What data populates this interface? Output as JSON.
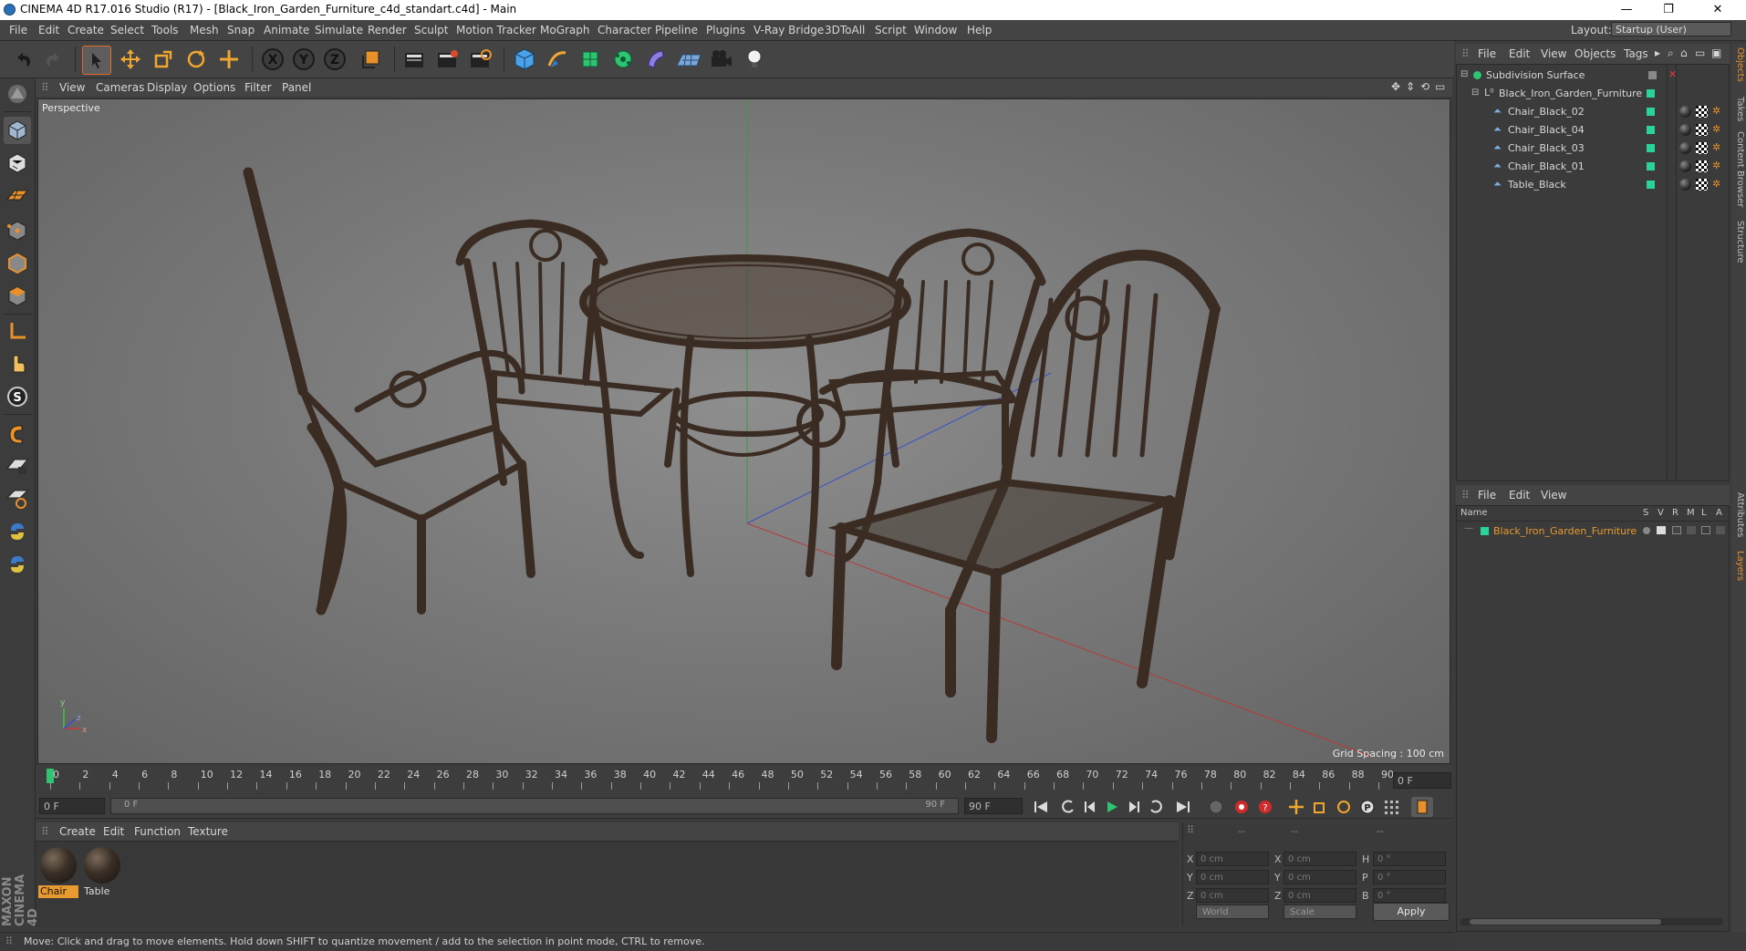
{
  "window": {
    "title": "CINEMA 4D R17.016 Studio (R17) - [Black_Iron_Garden_Furniture_c4d_standart.c4d] - Main",
    "minimize": "—",
    "restore": "❐",
    "close": "✕"
  },
  "menubar": {
    "items": [
      "File",
      "Edit",
      "Create",
      "Select",
      "Tools",
      "Mesh",
      "Snap",
      "Animate",
      "Simulate",
      "Render",
      "Sculpt",
      "Motion Tracker",
      "MoGraph",
      "Character",
      "Pipeline",
      "Plugins",
      "V-Ray Bridge",
      "3DToAll",
      "Script",
      "Window",
      "Help"
    ],
    "layout_label": "Layout:",
    "layout_value": "Startup (User)"
  },
  "toolbar": {
    "icons": [
      "undo-icon",
      "redo-icon",
      "select-icon",
      "move-icon",
      "scale-icon",
      "rotate-icon",
      "live-select-icon",
      "x-axis-icon",
      "y-axis-icon",
      "z-axis-icon",
      "coordinate-system-icon",
      "render-view-icon",
      "render-picture-icon",
      "render-settings-icon",
      "cube-icon",
      "pen-icon",
      "subdivision-icon",
      "cloner-icon",
      "deformer-icon",
      "floor-icon",
      "camera-icon",
      "light-icon"
    ],
    "x_label": "X",
    "y_label": "Y",
    "z_label": "Z"
  },
  "viewport": {
    "menu": [
      "View",
      "Cameras",
      "Display",
      "Options",
      "Filter",
      "Panel"
    ],
    "label": "Perspective",
    "grid_spacing": "Grid Spacing : 100 cm",
    "axis_y": "y",
    "axis_z": "z",
    "axis_x": "x"
  },
  "timeline": {
    "ticks": [
      "0",
      "2",
      "4",
      "6",
      "8",
      "10",
      "12",
      "14",
      "16",
      "18",
      "20",
      "22",
      "24",
      "26",
      "28",
      "30",
      "32",
      "34",
      "36",
      "38",
      "40",
      "42",
      "44",
      "46",
      "48",
      "50",
      "52",
      "54",
      "56",
      "58",
      "60",
      "62",
      "64",
      "66",
      "68",
      "70",
      "72",
      "74",
      "76",
      "78",
      "80",
      "82",
      "84",
      "86",
      "88",
      "90"
    ],
    "current_frame_field": "0 F",
    "start_field": "0 F",
    "range_start": "0 F",
    "range_end": "90 F",
    "end_field": "90 F"
  },
  "materials": {
    "menu": [
      "Create",
      "Edit",
      "Function",
      "Texture"
    ],
    "items": [
      {
        "name": "Chair",
        "selected": true
      },
      {
        "name": "Table",
        "selected": false
      }
    ],
    "logo": "MAXON CINEMA 4D"
  },
  "coordinates": {
    "headers": [
      "--",
      "--",
      "--"
    ],
    "rows": [
      {
        "l1": "X",
        "v1": "0 cm",
        "l2": "X",
        "v2": "0 cm",
        "l3": "H",
        "v3": "0 °"
      },
      {
        "l1": "Y",
        "v1": "0 cm",
        "l2": "Y",
        "v2": "0 cm",
        "l3": "P",
        "v3": "0 °"
      },
      {
        "l1": "Z",
        "v1": "0 cm",
        "l2": "Z",
        "v2": "0 cm",
        "l3": "B",
        "v3": "0 °"
      }
    ],
    "mode_world": "World",
    "mode_scale": "Scale",
    "apply": "Apply"
  },
  "status": {
    "text": "Move: Click and drag to move elements. Hold down SHIFT to quantize movement / add to the selection in point mode, CTRL to remove."
  },
  "object_manager": {
    "menu": [
      "File",
      "Edit",
      "View",
      "Objects",
      "Tags"
    ],
    "objects": [
      {
        "name": "Subdivision Surface",
        "level": 0
      },
      {
        "name": "Black_Iron_Garden_Furniture",
        "level": 1
      },
      {
        "name": "Chair_Black_02",
        "level": 2
      },
      {
        "name": "Chair_Black_04",
        "level": 2
      },
      {
        "name": "Chair_Black_03",
        "level": 2
      },
      {
        "name": "Chair_Black_01",
        "level": 2
      },
      {
        "name": "Table_Black",
        "level": 2
      }
    ],
    "accent_color": "#2ad39a"
  },
  "layer_manager": {
    "menu": [
      "File",
      "Edit",
      "View"
    ],
    "col_name": "Name",
    "cols": [
      "S",
      "V",
      "R",
      "M",
      "L",
      "A"
    ],
    "layers": [
      {
        "name": "Black_Iron_Garden_Furniture",
        "color": "#e89a30"
      }
    ]
  },
  "right_tabs": [
    "Objects",
    "Takes",
    "Content Browser",
    "Structure",
    "Attributes",
    "Layers"
  ]
}
